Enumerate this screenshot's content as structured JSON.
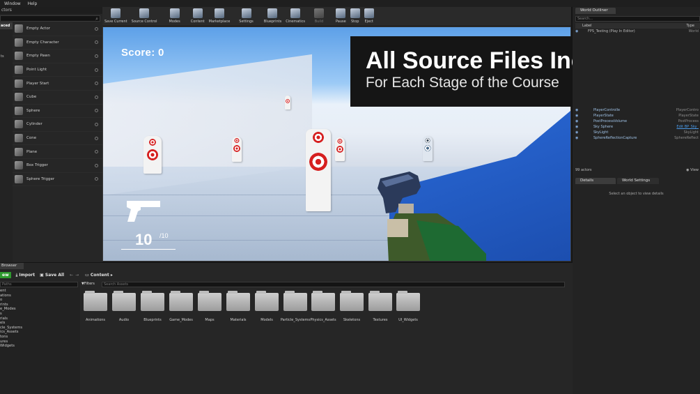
{
  "menu": {
    "items": [
      "Window",
      "Help"
    ]
  },
  "left_panel": {
    "tab_label": "ctors",
    "categories": [
      "aced",
      "",
      "ts"
    ],
    "actors": [
      "Empty Actor",
      "Empty Character",
      "Empty Pawn",
      "Point Light",
      "Player Start",
      "Cube",
      "Sphere",
      "Cylinder",
      "Cone",
      "Plane",
      "Box Trigger",
      "Sphere Trigger"
    ]
  },
  "toolbar": {
    "buttons": [
      {
        "label": "Save Current",
        "icon": "save-icon"
      },
      {
        "label": "Source Control",
        "icon": "source-control-icon"
      },
      {
        "label": "Modes",
        "icon": "modes-icon"
      },
      {
        "label": "Content",
        "icon": "content-icon"
      },
      {
        "label": "Marketplace",
        "icon": "marketplace-icon"
      },
      {
        "label": "Settings",
        "icon": "settings-icon"
      },
      {
        "label": "Blueprints",
        "icon": "blueprints-icon"
      },
      {
        "label": "Cinematics",
        "icon": "cinematics-icon"
      },
      {
        "label": "Build",
        "icon": "build-icon"
      },
      {
        "label": "Pause",
        "icon": "pause-icon"
      },
      {
        "label": "Stop",
        "icon": "stop-icon"
      },
      {
        "label": "Eject",
        "icon": "eject-icon"
      }
    ]
  },
  "hud": {
    "score_label": "Score:  0",
    "ammo_current": "10",
    "ammo_separator_max": "/10"
  },
  "banner": {
    "title": "All Source Files Included!",
    "subtitle": "For Each Stage of the Course"
  },
  "outliner": {
    "tab_label": "World Outliner",
    "search_placeholder": "Search...",
    "col_label": "Label",
    "col_type": "Type",
    "top_row": {
      "label": "FPS_Testing (Play In Editor)",
      "type": "World"
    },
    "rows": [
      {
        "label": "PlayerControlle",
        "type": "PlayerContro"
      },
      {
        "label": "PlayerState",
        "type": "PlayerState"
      },
      {
        "label": "PostProcessVolume",
        "type": "PostProcess"
      },
      {
        "label": "Sky Sphere",
        "type": "Edit BP_Sky_"
      },
      {
        "label": "SkyLight",
        "type": "SkyLight"
      },
      {
        "label": "SphereReflectionCapture",
        "type": "SphereReflect"
      }
    ],
    "actor_count": "99 actors",
    "view_label": "View"
  },
  "details": {
    "tab_label": "Details",
    "world_settings_label": "World Settings",
    "message": "Select an object to view details"
  },
  "content_browser": {
    "tab_label": "Browser",
    "add_new_label": "ew",
    "import_label": "Import",
    "save_all_label": "Save All",
    "path_label": "Content",
    "filters_label": "Filters",
    "search_placeholder": "Search Assets",
    "tree_search_placeholder": "Paths",
    "tree_items": [
      "ent",
      "ations",
      "o",
      "rints",
      "e_Modes",
      "s",
      "rials",
      "els",
      "cle_Systems",
      "ics_Assets",
      "tons",
      "ures",
      "Widgets"
    ],
    "folders": [
      "Animations",
      "Audio",
      "Blueprints",
      "Game_Modes",
      "Maps",
      "Materials",
      "Models",
      "Particle_Systems",
      "Physics_Assets",
      "Skeletons",
      "Textures",
      "UI_Widgets"
    ]
  },
  "colors": {
    "add_new_green": "#2e9a2e",
    "target_red": "#d62020",
    "sky_blue": "#5da0e8",
    "wall_blue": "#2a6ad8"
  }
}
